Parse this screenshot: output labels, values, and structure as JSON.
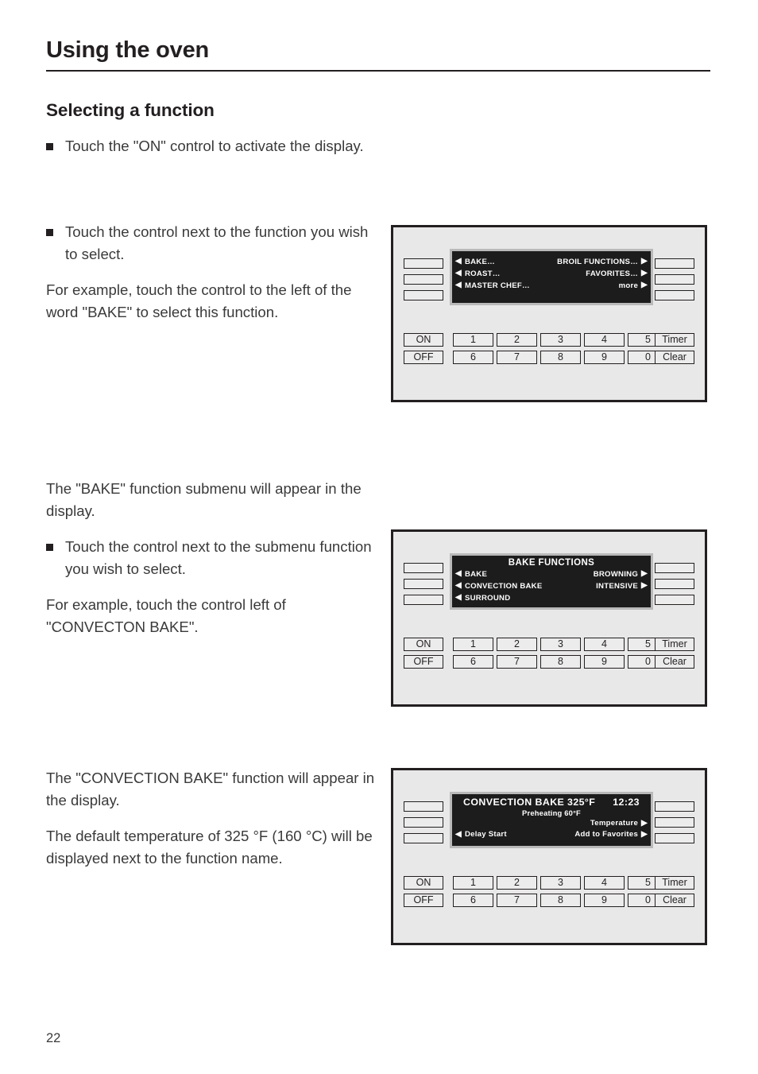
{
  "header": {
    "chapter_title": "Using the oven"
  },
  "section": {
    "heading": "Selecting a function"
  },
  "body": {
    "p1_bullet": "Touch the \"ON\" control to activate the display.",
    "p2_bullet": "Touch the control next to the function you wish to select.",
    "p3": "For example, touch the control to the left of the word \"BAKE\" to select this function.",
    "p4": "The \"BAKE\" function submenu will appear in the display.",
    "p5_bullet": "Touch the control next to the submenu function you wish to select.",
    "p6": "For example, touch the control left of \"CONVECTON BAKE\".",
    "p7": "The \"CONVECTION BAKE\" function will appear in the display.",
    "p8": "The default temperature of 325 °F (160 °C) will be displayed next to the function name."
  },
  "panel_common": {
    "on_label": "ON",
    "off_label": "OFF",
    "timer_label": "Timer",
    "clear_label": "Clear",
    "numpad_row1": [
      "1",
      "2",
      "3",
      "4",
      "5"
    ],
    "numpad_row2": [
      "6",
      "7",
      "8",
      "9",
      "0"
    ],
    "arrow_left": "◀",
    "arrow_right": "▶",
    "lcd_background": "#1c1c1c",
    "lcd_text_color": "#ffffff",
    "panel_background": "#e8e8e8"
  },
  "figure1": {
    "lcd": {
      "title": "",
      "rows": [
        {
          "left": "BAKE…",
          "right": "BROIL FUNCTIONS…"
        },
        {
          "left": "ROAST…",
          "right": "FAVORITES…"
        },
        {
          "left": "MASTER CHEF…",
          "right": "more"
        }
      ]
    }
  },
  "figure2": {
    "lcd": {
      "title": "BAKE FUNCTIONS",
      "rows": [
        {
          "left": "BAKE",
          "right": "BROWNING"
        },
        {
          "left": "CONVECTION BAKE",
          "right": "INTENSIVE"
        },
        {
          "left": "SURROUND",
          "right": ""
        }
      ]
    }
  },
  "figure3": {
    "lcd": {
      "function_name": "CONVECTION BAKE 325°F",
      "clock": "12:23",
      "status": "Preheating 60°F",
      "rows": [
        {
          "left": "",
          "right": "Temperature"
        },
        {
          "left": "Delay Start",
          "right": "Add to Favorites"
        }
      ]
    }
  },
  "footer": {
    "page_number": "22"
  }
}
